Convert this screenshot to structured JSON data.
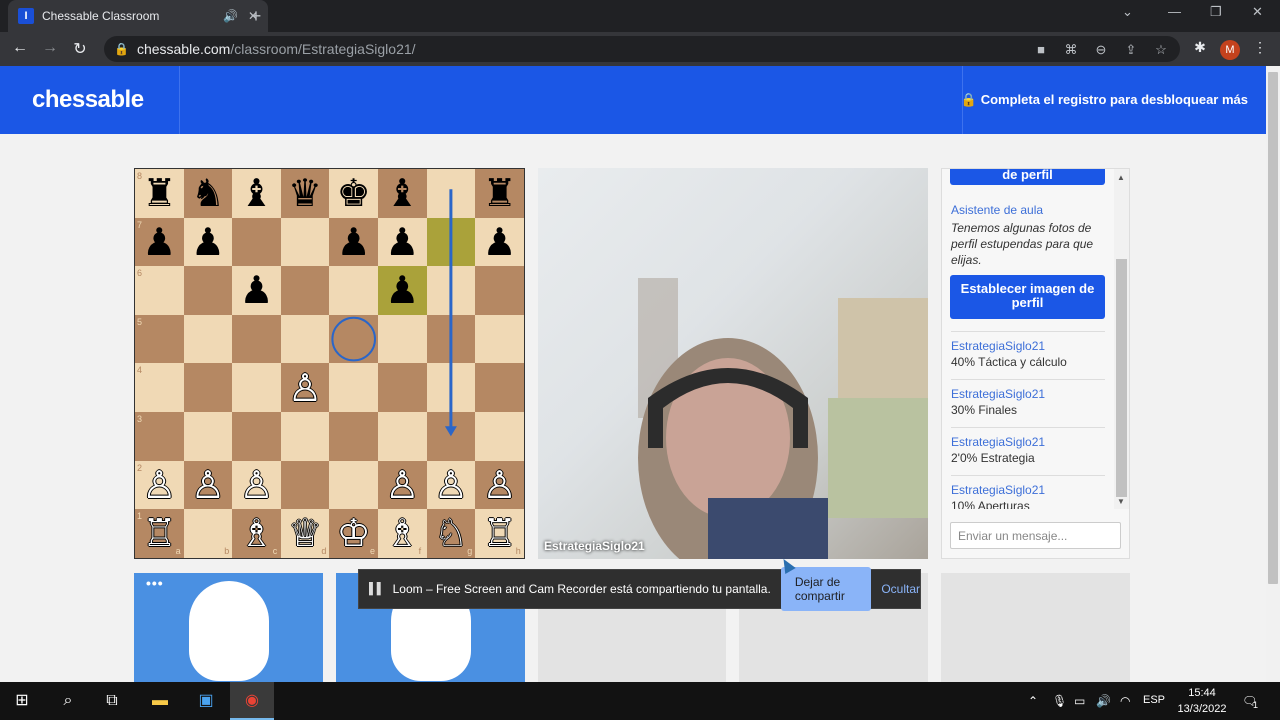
{
  "browser": {
    "tab_title": "Chessable Classroom",
    "tab_favicon": "I",
    "new_tab_icon": "+",
    "url_domain": "chessable.com",
    "url_path": "/classroom/EstrategiaSiglo21/",
    "profile_initial": "M"
  },
  "header": {
    "logo": "chessable",
    "register": "Completa el registro para desbloquear más"
  },
  "board": {
    "ranks": [
      "8",
      "7",
      "6",
      "5",
      "4",
      "3",
      "2",
      "1"
    ],
    "files": [
      "a",
      "b",
      "c",
      "d",
      "e",
      "f",
      "g",
      "h"
    ],
    "pieces": [
      {
        "sq": "a8",
        "g": "♜",
        "c": "b"
      },
      {
        "sq": "b8",
        "g": "♞",
        "c": "b"
      },
      {
        "sq": "c8",
        "g": "♝",
        "c": "b"
      },
      {
        "sq": "d8",
        "g": "♛",
        "c": "b"
      },
      {
        "sq": "e8",
        "g": "♚",
        "c": "b"
      },
      {
        "sq": "f8",
        "g": "♝",
        "c": "b"
      },
      {
        "sq": "h8",
        "g": "♜",
        "c": "b"
      },
      {
        "sq": "a7",
        "g": "♟",
        "c": "b"
      },
      {
        "sq": "b7",
        "g": "♟",
        "c": "b"
      },
      {
        "sq": "e7",
        "g": "♟",
        "c": "b"
      },
      {
        "sq": "f7",
        "g": "♟",
        "c": "b"
      },
      {
        "sq": "h7",
        "g": "♟",
        "c": "b"
      },
      {
        "sq": "c6",
        "g": "♟",
        "c": "b"
      },
      {
        "sq": "f6",
        "g": "♟",
        "c": "b"
      },
      {
        "sq": "d4",
        "g": "♙",
        "c": "w"
      },
      {
        "sq": "a2",
        "g": "♙",
        "c": "w"
      },
      {
        "sq": "b2",
        "g": "♙",
        "c": "w"
      },
      {
        "sq": "c2",
        "g": "♙",
        "c": "w"
      },
      {
        "sq": "f2",
        "g": "♙",
        "c": "w"
      },
      {
        "sq": "g2",
        "g": "♙",
        "c": "w"
      },
      {
        "sq": "h2",
        "g": "♙",
        "c": "w"
      },
      {
        "sq": "a1",
        "g": "♖",
        "c": "w"
      },
      {
        "sq": "c1",
        "g": "♗",
        "c": "w"
      },
      {
        "sq": "d1",
        "g": "♕",
        "c": "w"
      },
      {
        "sq": "e1",
        "g": "♔",
        "c": "w"
      },
      {
        "sq": "f1",
        "g": "♗",
        "c": "w"
      },
      {
        "sq": "g1",
        "g": "♘",
        "c": "w"
      },
      {
        "sq": "h1",
        "g": "♖",
        "c": "w"
      }
    ],
    "highlights": [
      "g7",
      "f6"
    ],
    "circle": "e5",
    "arrow": {
      "from": "g8",
      "to": "g3"
    },
    "arrow_color": "#2a66c9"
  },
  "video": {
    "label": "EstrategiaSiglo21"
  },
  "chat": {
    "top_button": "de perfil",
    "assistant_name": "Asistente de aula",
    "assistant_msg": "Tenemos algunas fotos de perfil estupendas para que elijas.",
    "set_image_button": "Establecer imagen de perfil",
    "messages": [
      {
        "user": "EstrategiaSiglo21",
        "text": "40% Táctica y cálculo"
      },
      {
        "user": "EstrategiaSiglo21",
        "text": "30% Finales"
      },
      {
        "user": "EstrategiaSiglo21",
        "text": "2'0% Estrategia"
      },
      {
        "user": "EstrategiaSiglo21",
        "text": "10% Aperturas"
      }
    ],
    "input_placeholder": "Enviar un mensaje..."
  },
  "participants": {
    "menu_dots": "•••"
  },
  "loom": {
    "message": "Loom – Free Screen and Cam Recorder está compartiendo tu pantalla.",
    "stop": "Dejar de compartir",
    "hide": "Ocultar"
  },
  "taskbar": {
    "language": "ESP",
    "time": "15:44",
    "date": "13/3/2022",
    "notification_count": "1"
  },
  "colors": {
    "brand": "#1b57e6",
    "light_square": "#f0d9b5",
    "dark_square": "#b58863"
  }
}
